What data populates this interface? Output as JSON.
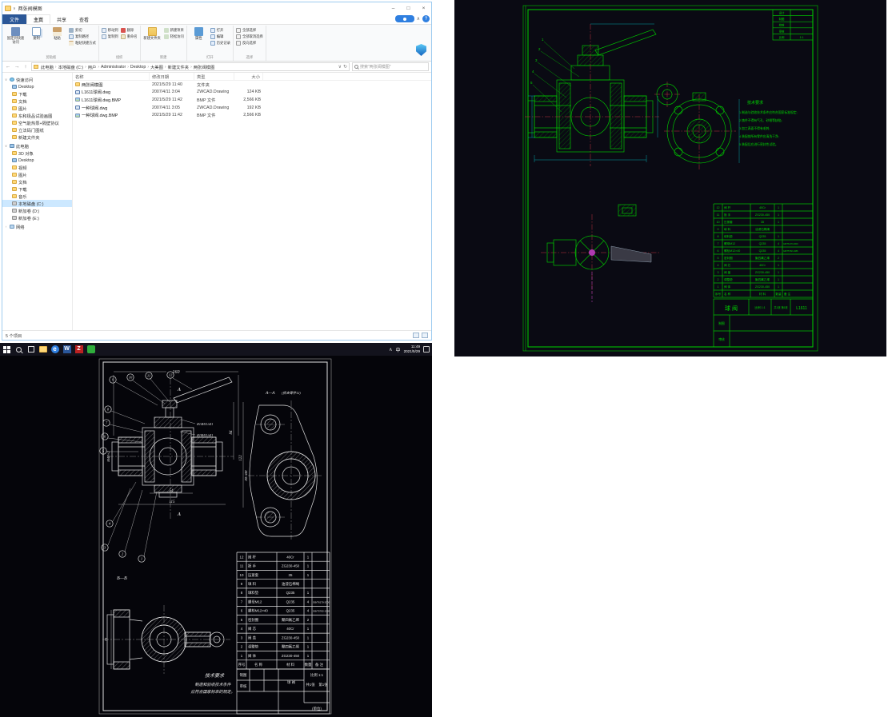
{
  "explorer": {
    "title": "两张阀模图",
    "tabs": {
      "file": "文件",
      "home": "主页",
      "share": "共享",
      "view": "查看"
    },
    "ribbon": {
      "clipboard": {
        "label": "剪贴板",
        "pin": "固定到快速访问",
        "copy": "复制",
        "paste": "粘贴",
        "cut": "剪切",
        "copy_path": "复制路径",
        "paste_shortcut": "粘贴快捷方式"
      },
      "organize": {
        "label": "组织",
        "move": "移动到",
        "copy_to": "复制到",
        "delete": "删除",
        "rename": "重命名"
      },
      "new": {
        "label": "新建",
        "new_folder": "新建文件夹",
        "new_item": "新建项目",
        "easy_access": "轻松访问"
      },
      "open": {
        "label": "打开",
        "properties": "属性",
        "open": "打开",
        "edit": "编辑",
        "history": "历史记录"
      },
      "select": {
        "label": "选择",
        "select_all": "全部选择",
        "select_none": "全部取消选择",
        "invert": "反向选择"
      }
    },
    "address": {
      "path": [
        "此电脑",
        "本地磁盘 (C:)",
        "用户",
        "Administrator",
        "Desktop",
        "大美图",
        "新建文件夹",
        "两张阀模图"
      ],
      "search_placeholder": "搜索\"两张阀模图\""
    },
    "columns": [
      "名称",
      "修改日期",
      "类型",
      "大小"
    ],
    "files": [
      {
        "name": "两张阀模图",
        "date": "2021/5/29 11:40",
        "type": "文件夹",
        "size": ""
      },
      {
        "name": "L1611球阀.dwg",
        "date": "2007/4/11 3:04",
        "type": "ZWCAD.Drawing",
        "size": "124 KB"
      },
      {
        "name": "L1611球阀.dwg.BMP",
        "date": "2021/5/29 11:42",
        "type": "BMP 文件",
        "size": "2,566 KB"
      },
      {
        "name": "一种球阀.dwg",
        "date": "2007/4/11 3:05",
        "type": "ZWCAD.Drawing",
        "size": "192 KB"
      },
      {
        "name": "一种球阀.dwg.BMP",
        "date": "2021/5/29 11:42",
        "type": "BMP 文件",
        "size": "2,566 KB"
      }
    ],
    "nav": {
      "quick_access": "快速访问",
      "quick": [
        "Desktop",
        "下载",
        "文档",
        "图片",
        "东和极品试验画图",
        "空气能热泵+隔壁协议",
        "立法码门图纸",
        "新建文件夹"
      ],
      "this_pc": "此电脑",
      "pc": [
        "3D 对象",
        "Desktop",
        "视频",
        "图片",
        "文档",
        "下载",
        "音乐",
        "本地磁盘 (C:)",
        "新加卷 (D:)",
        "新加卷 (E:)"
      ],
      "network": "网络"
    },
    "status": "5 个项目"
  },
  "taskbar": {
    "time": "11:49",
    "date": "2021/5/29",
    "lang": "中"
  },
  "valve_parts": {
    "header": [
      "序号",
      "名 称",
      "材 料",
      "数量",
      "备 注"
    ],
    "rows": [
      [
        "12",
        "阀 杆",
        "40Cr",
        "1",
        ""
      ],
      [
        "11",
        "扳 手",
        "ZG230-450",
        "1",
        ""
      ],
      [
        "10",
        "压紧套",
        "35",
        "1",
        ""
      ],
      [
        "9",
        "填 料",
        "油浸石棉绳",
        "",
        ""
      ],
      [
        "8",
        "填料垫",
        "Q235",
        "1",
        ""
      ],
      [
        "7",
        "螺母M12",
        "Q235",
        "4",
        "GB/T6170-2000"
      ],
      [
        "6",
        "螺栓M12×40",
        "Q235",
        "4",
        "GB/T5782-1986"
      ],
      [
        "5",
        "密封圈",
        "聚四氟乙烯",
        "2",
        ""
      ],
      [
        "4",
        "阀 芯",
        "40Cr",
        "1",
        ""
      ],
      [
        "3",
        "阀 盖",
        "ZG230-450",
        "1",
        ""
      ],
      [
        "2",
        "调整垫",
        "聚四氟乙烯",
        "1",
        ""
      ],
      [
        "1",
        "阀 体",
        "ZG230-450",
        "1",
        ""
      ]
    ]
  },
  "cad_green": {
    "leaders": [
      "1",
      "2",
      "3",
      "4",
      "5"
    ],
    "corner_table": [
      [
        "设计",
        ""
      ],
      [
        "制图",
        ""
      ],
      [
        "校核",
        ""
      ],
      [
        "审核",
        ""
      ],
      [
        "比例",
        "1:1"
      ]
    ],
    "notes": {
      "title": "技术要求",
      "lines": [
        "1.制造与验收技术条件应符合国家标准规定;",
        "2.铸件不得有气孔、砂眼等缺陷;",
        "3.加工表面不得有毛刺;",
        "4.装配前所有零件应清洗干净;",
        "5.装配后应进行密封性试验。"
      ]
    },
    "titleblock": {
      "name": "球 阀",
      "no": "L1611",
      "scale": "比例 1:1",
      "sheet": "共1张 第1张",
      "draw": "制图",
      "check": "审核"
    }
  },
  "cad_white": {
    "dims": {
      "d160": "160",
      "d115": "115",
      "d54": "54",
      "d84": "84",
      "d122": "122",
      "m48": "M48×2",
      "d73": "73",
      "d80": "80×Ø8",
      "fit14": "Ø14H11/d11",
      "fit18": "Ø18H11/d11"
    },
    "balloons": [
      "1",
      "2",
      "3",
      "4",
      "5",
      "6",
      "7",
      "8",
      "9",
      "10",
      "11",
      "12"
    ],
    "labels": {
      "aa": "A—A",
      "aa_note": "(拆去零件12)",
      "bb": "B—B",
      "a_top": "A",
      "a_bot": "A"
    },
    "notes": {
      "title": "技术要求",
      "line1": "制造和验收技术条件",
      "line2": "应符合国家标准的规定。"
    },
    "titleblock": {
      "name": "球 阀",
      "scale": "比例 1:1",
      "sheet1": "共1张",
      "sheet2": "第1张",
      "draw": "制图",
      "check": "审核",
      "unit": "(单位)"
    }
  }
}
